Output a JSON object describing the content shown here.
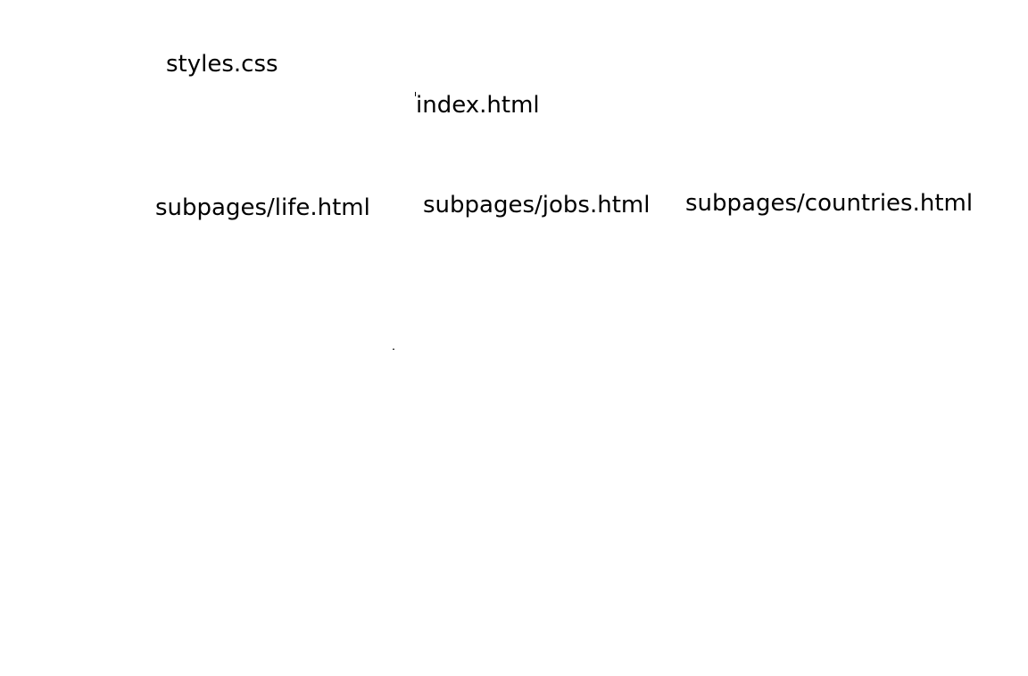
{
  "files": {
    "styles": "styles.css",
    "index": "index.html",
    "life": "subpages/life.html",
    "jobs": "subpages/jobs.html",
    "countries": "subpages/countries.html"
  },
  "colors": {
    "background": "#ffffff",
    "text": "#000000"
  }
}
